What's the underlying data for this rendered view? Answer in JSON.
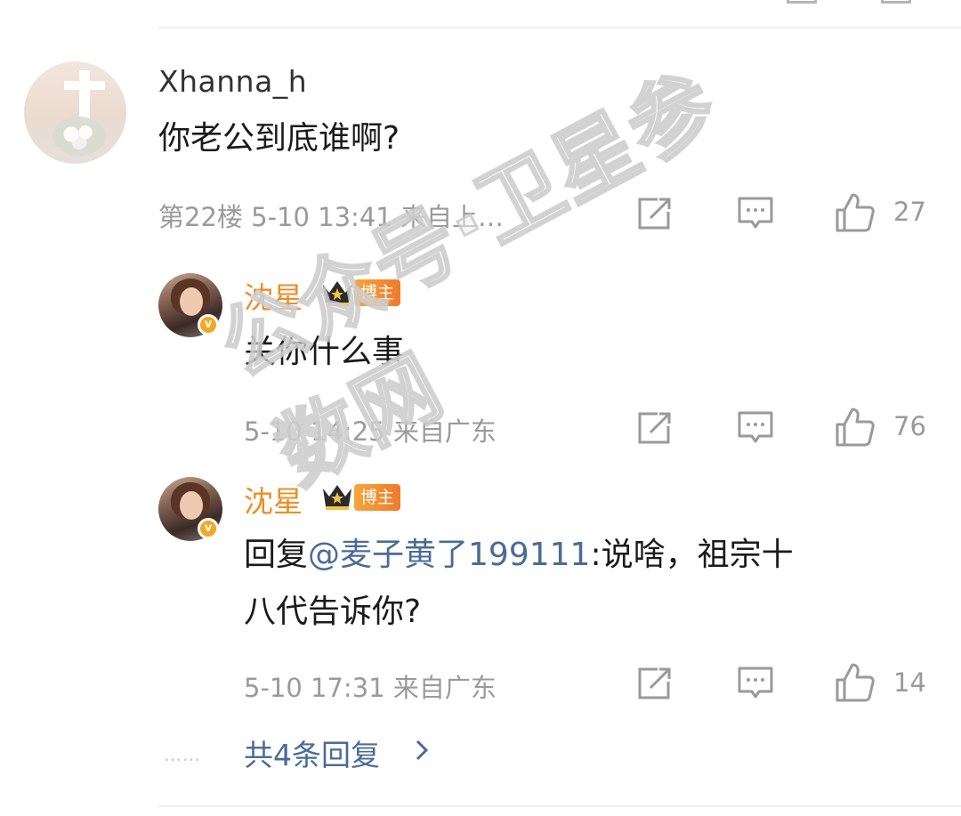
{
  "main_comment": {
    "username": "Xhanna_h",
    "text": "你老公到底谁啊?",
    "meta": "第22楼 5-10 13:41 来自上…",
    "likes": "27"
  },
  "replies": [
    {
      "username": "沈星",
      "tag": "博主",
      "text": "关你什么事",
      "meta": "5-10 14:25 来自广东",
      "likes": "76"
    },
    {
      "username": "沈星",
      "tag": "博主",
      "text_prefix": "回复",
      "mention": "@麦子黄了199111",
      "text_line1_suffix": ":说啥，祖宗十",
      "text_line2": "八代告诉你?",
      "meta": "5-10 17:31 来自广东",
      "likes": "14"
    }
  ],
  "more_replies": {
    "dots": "……",
    "label": "共4条回复"
  },
  "watermark": "公众号·卫星参数网",
  "icons": {
    "share": "share-icon",
    "comment": "comment-icon",
    "like": "thumbs-up-icon",
    "crown": "crown-icon",
    "verified": "verified-badge-icon",
    "chevron": "chevron-right-icon"
  },
  "colors": {
    "blogger_name": "#f08c24",
    "mention": "#4a6b99",
    "meta": "#9a9a9a",
    "tag_bg": "#f5a623"
  }
}
